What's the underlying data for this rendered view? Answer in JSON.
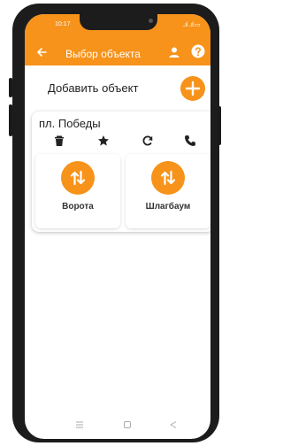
{
  "status": {
    "time": "10:17",
    "indicators": "..ıl ..ıl ▭"
  },
  "header": {
    "title": "Выбор объекта"
  },
  "add_object": {
    "label": "Добавить объект"
  },
  "card": {
    "title": "пл. Победы",
    "devices": [
      {
        "label": "Ворота"
      },
      {
        "label": "Шлагбаум"
      }
    ]
  },
  "colors": {
    "accent": "#f7931a",
    "frame": "#1c1c1c"
  },
  "icons": [
    "back-arrow-icon",
    "person-icon",
    "help-icon",
    "add-icon",
    "trash-icon",
    "star-icon",
    "refresh-icon",
    "phone-icon",
    "swap-arrows-icon",
    "menu-icon",
    "home-icon",
    "nav-back-icon"
  ]
}
